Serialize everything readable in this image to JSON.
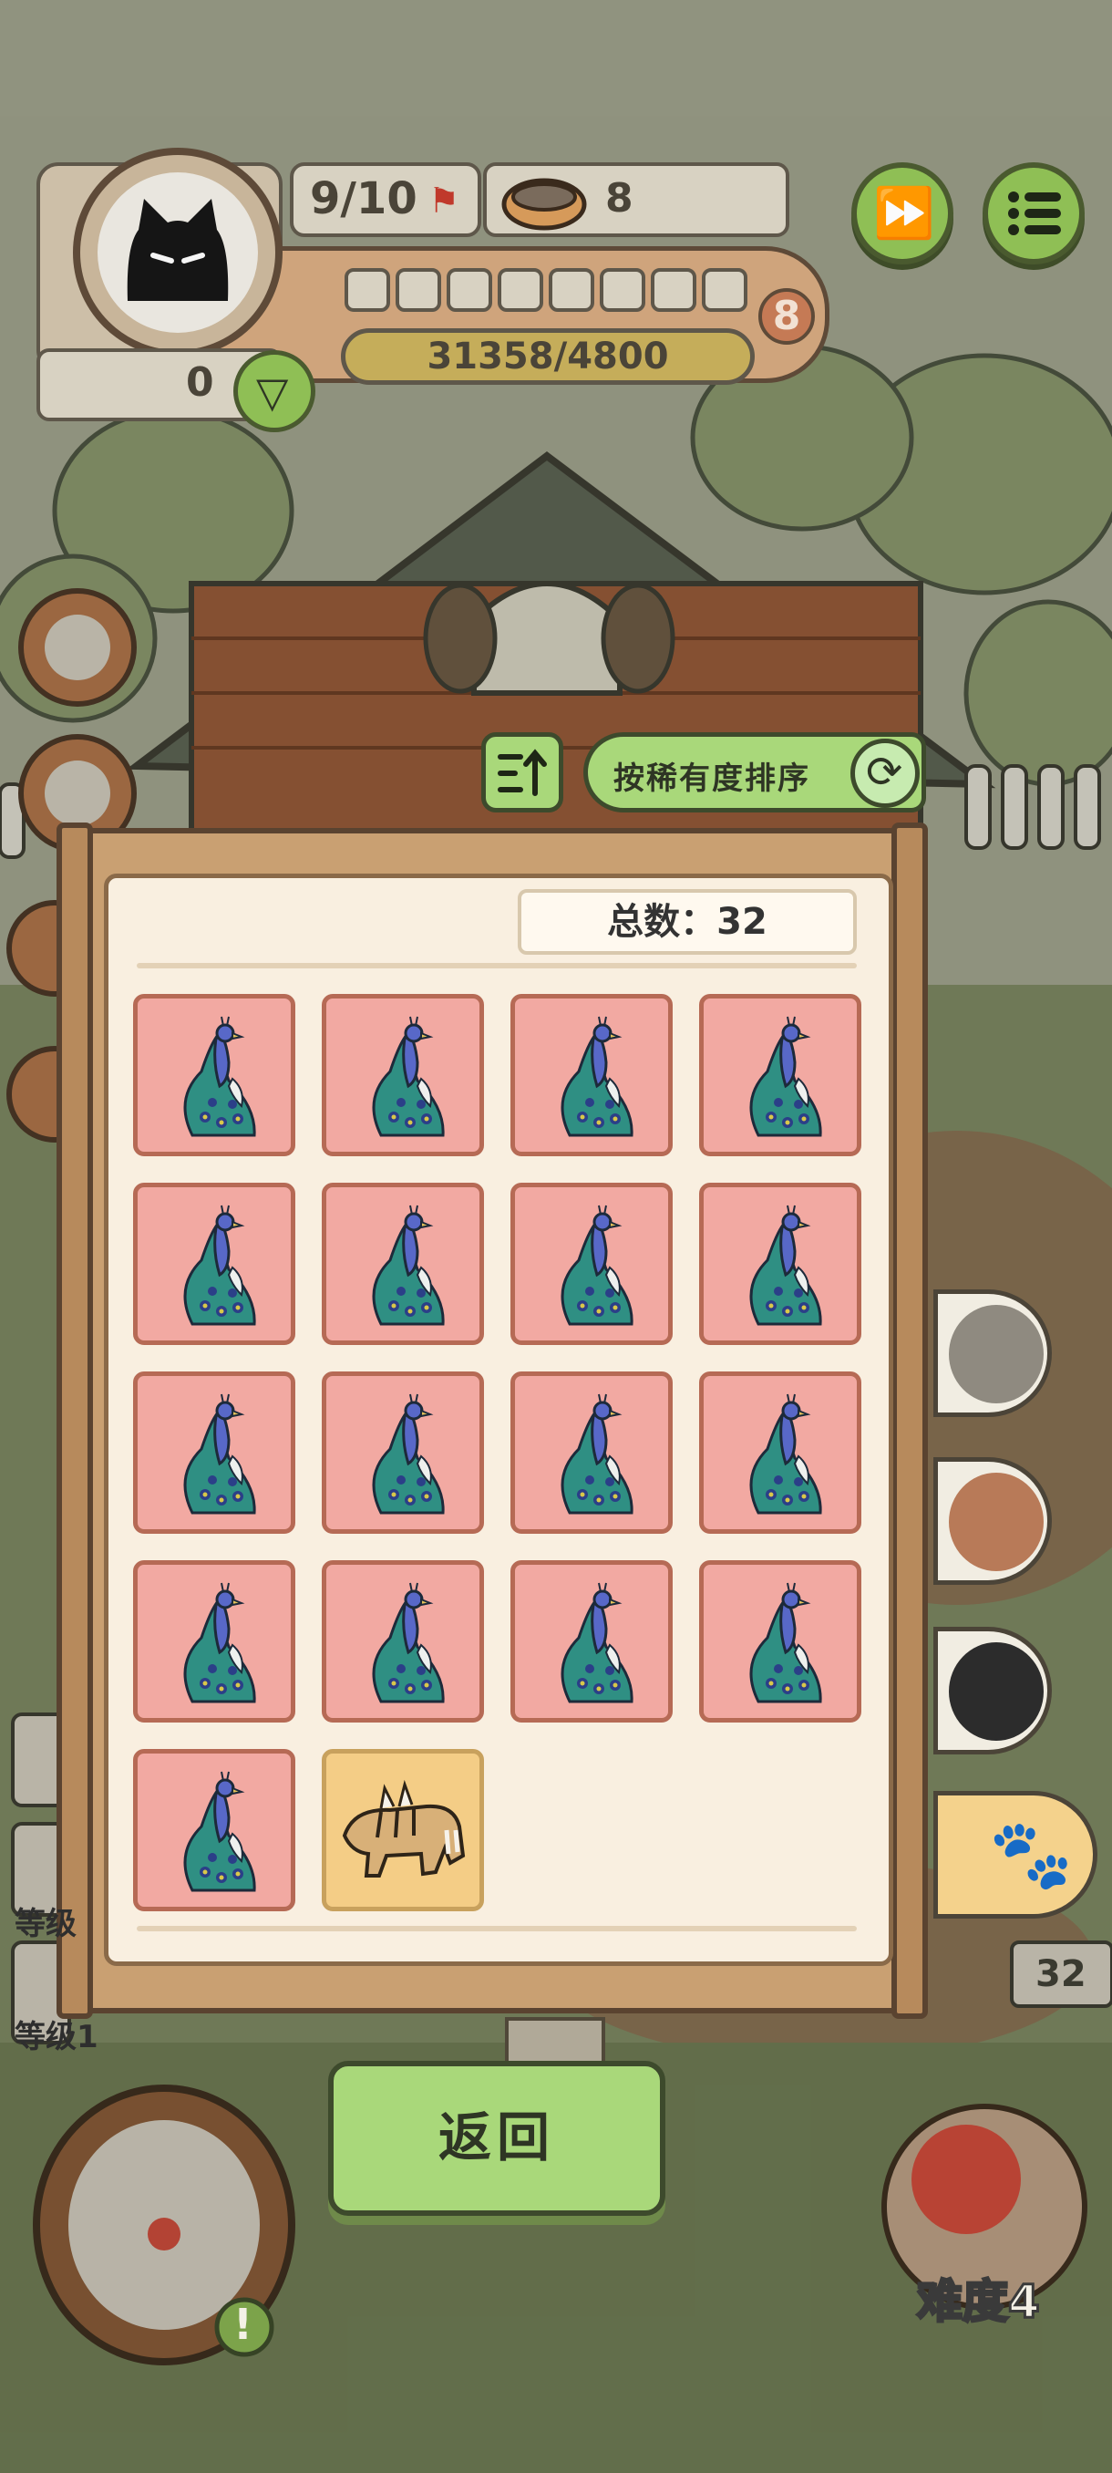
{
  "hud": {
    "level_progress": "9/10",
    "bowls": "8",
    "currency": "0",
    "experience": "31358/4800",
    "level_badge": "8",
    "skill_slots_filled": 0,
    "skill_slots_total": 8
  },
  "buttons": {
    "fast_forward": "fast-forward-icon",
    "menu": "list-menu-icon"
  },
  "sort": {
    "label": "按稀有度排序"
  },
  "board": {
    "total_label": "总数：32",
    "cards": [
      {
        "creature": "peacock",
        "rarity": "red"
      },
      {
        "creature": "peacock",
        "rarity": "red"
      },
      {
        "creature": "peacock",
        "rarity": "red"
      },
      {
        "creature": "peacock",
        "rarity": "red"
      },
      {
        "creature": "peacock",
        "rarity": "red"
      },
      {
        "creature": "peacock",
        "rarity": "red"
      },
      {
        "creature": "peacock",
        "rarity": "red"
      },
      {
        "creature": "peacock",
        "rarity": "red"
      },
      {
        "creature": "peacock",
        "rarity": "red"
      },
      {
        "creature": "peacock",
        "rarity": "red"
      },
      {
        "creature": "peacock",
        "rarity": "red"
      },
      {
        "creature": "peacock",
        "rarity": "red"
      },
      {
        "creature": "peacock",
        "rarity": "red"
      },
      {
        "creature": "peacock",
        "rarity": "red"
      },
      {
        "creature": "peacock",
        "rarity": "red"
      },
      {
        "creature": "peacock",
        "rarity": "red"
      },
      {
        "creature": "peacock",
        "rarity": "red"
      },
      {
        "creature": "saber-tooth-cat",
        "rarity": "gold"
      }
    ]
  },
  "footer": {
    "back_label": "返回",
    "difficulty_label": "难度4",
    "count_badge": "32",
    "level_tag_1": "等级1",
    "level_tag_2": "等级"
  },
  "colors": {
    "accent_green": "#a9d87a",
    "card_red": "#f2a9a2",
    "card_gold": "#f4cd86",
    "board_bg": "#f9efe0"
  }
}
